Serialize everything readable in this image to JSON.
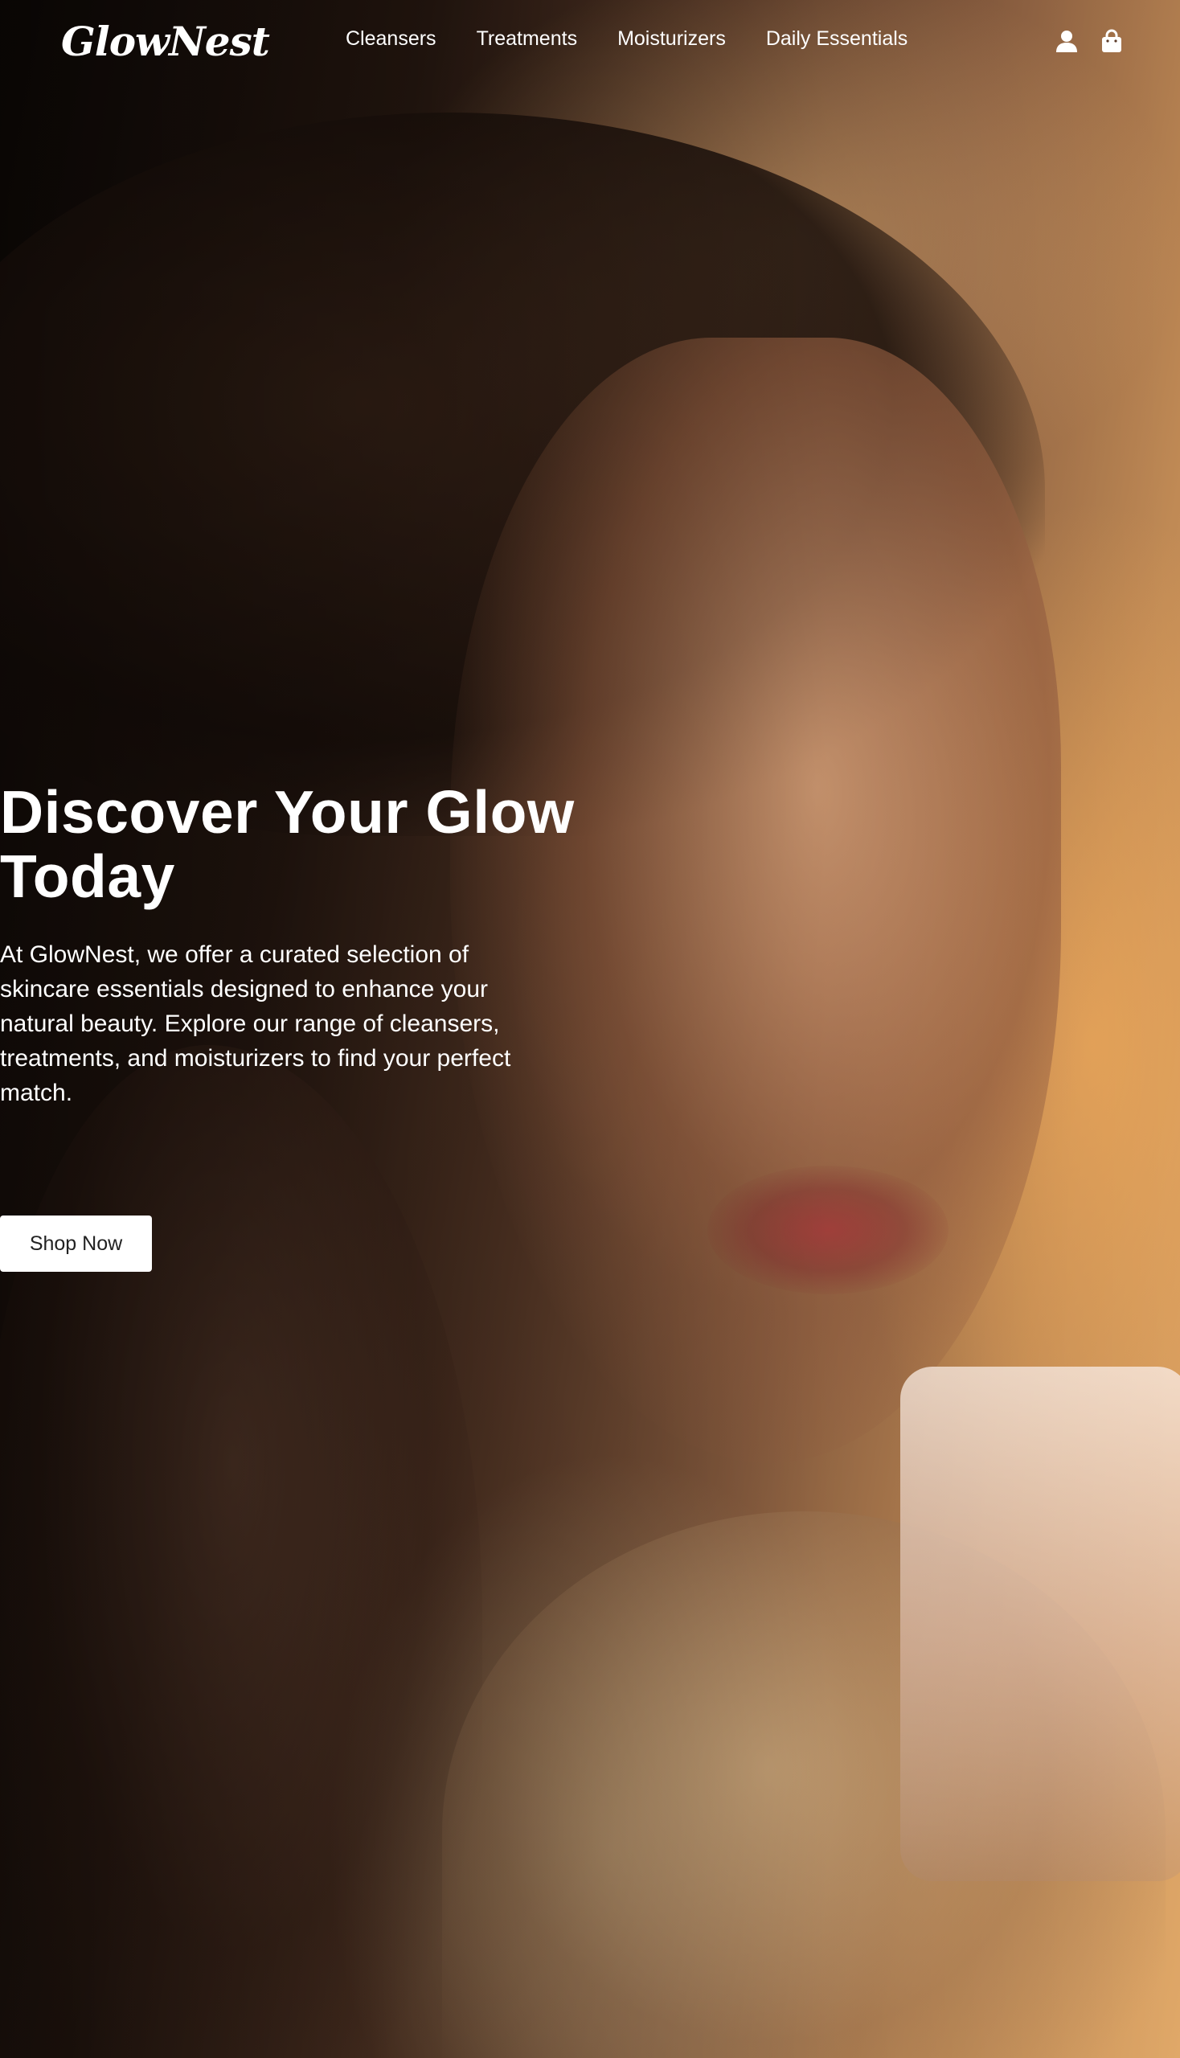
{
  "brand": {
    "logo_text": "GlowNest"
  },
  "nav": {
    "items": [
      {
        "label": "Cleansers"
      },
      {
        "label": "Treatments"
      },
      {
        "label": "Moisturizers"
      },
      {
        "label": "Daily Essentials"
      }
    ]
  },
  "header_icons": {
    "account": "user-icon",
    "cart": "shopping-bag-icon"
  },
  "hero": {
    "title": "Discover Your Glow Today",
    "description": "At GlowNest, we offer a curated selection of skincare essentials designed to enhance your natural beauty. Explore our range of cleansers, treatments, and moisturizers to find your perfect match.",
    "cta_label": "Shop Now"
  },
  "colors": {
    "text": "#ffffff",
    "button_bg": "#ffffff",
    "button_text": "#222222"
  }
}
